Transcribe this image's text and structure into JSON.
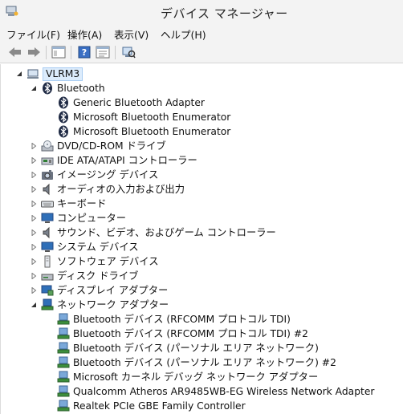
{
  "window": {
    "title": "デバイス マネージャー"
  },
  "menu": [
    {
      "label": "ファイル(F)"
    },
    {
      "label": "操作(A)"
    },
    {
      "label": "表示(V)"
    },
    {
      "label": "ヘルプ(H)"
    }
  ],
  "toolbar": {
    "buttons": [
      "back-arrow-icon",
      "forward-arrow-icon",
      "show-hide-console-tree-icon",
      "help-icon",
      "properties-icon",
      "scan-hardware-icon"
    ]
  },
  "tree": {
    "root": "VLRM3",
    "categories": [
      {
        "label": "Bluetooth",
        "icon": "bluetooth-icon",
        "expanded": true,
        "children": [
          "Generic Bluetooth Adapter",
          "Microsoft Bluetooth Enumerator",
          "Microsoft Bluetooth Enumerator"
        ]
      },
      {
        "label": "DVD/CD-ROM ドライブ",
        "icon": "dvd-drive-icon",
        "expanded": false
      },
      {
        "label": "IDE ATA/ATAPI コントローラー",
        "icon": "ide-controller-icon",
        "expanded": false
      },
      {
        "label": "イメージング デバイス",
        "icon": "camera-icon",
        "expanded": false
      },
      {
        "label": "オーディオの入力および出力",
        "icon": "speaker-icon",
        "expanded": false
      },
      {
        "label": "キーボード",
        "icon": "keyboard-icon",
        "expanded": false
      },
      {
        "label": "コンピューター",
        "icon": "computer-icon",
        "expanded": false
      },
      {
        "label": "サウンド、ビデオ、およびゲーム コントローラー",
        "icon": "speaker-icon",
        "expanded": false
      },
      {
        "label": "システム デバイス",
        "icon": "computer-icon",
        "expanded": false
      },
      {
        "label": "ソフトウェア デバイス",
        "icon": "software-device-icon",
        "expanded": false
      },
      {
        "label": "ディスク ドライブ",
        "icon": "disk-drive-icon",
        "expanded": false
      },
      {
        "label": "ディスプレイ アダプター",
        "icon": "display-adapter-icon",
        "expanded": false
      },
      {
        "label": "ネットワーク アダプター",
        "icon": "network-adapter-icon",
        "expanded": true,
        "children": [
          "Bluetooth デバイス (RFCOMM プロトコル TDI)",
          "Bluetooth デバイス (RFCOMM プロトコル TDI) #2",
          "Bluetooth デバイス (パーソナル エリア ネットワーク)",
          "Bluetooth デバイス (パーソナル エリア ネットワーク) #2",
          "Microsoft カーネル デバッグ ネットワーク アダプター",
          "Qualcomm Atheros AR9485WB-EG Wireless Network Adapter",
          "Realtek PCIe GBE Family Controller"
        ]
      }
    ]
  },
  "colors": {
    "chrome": "#f3f3f3",
    "selection": "#dcecfc",
    "bluetooth": "#1f2a44",
    "network": "#2e7d32"
  }
}
